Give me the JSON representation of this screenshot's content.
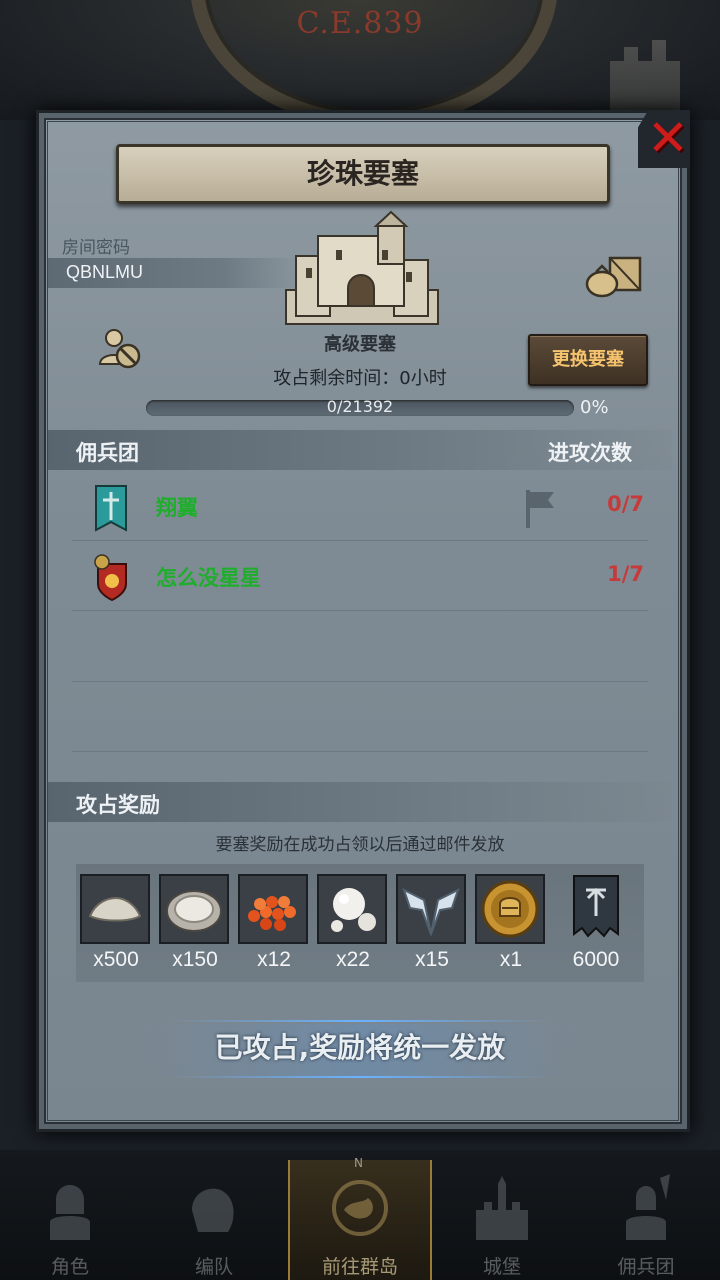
{
  "background": {
    "era": "C.E.839"
  },
  "panel": {
    "title": "珍珠要塞",
    "room_label": "房间密码",
    "room_code": "QBNLMU",
    "fortress_name": "高级要塞",
    "change_button": "更换要塞",
    "time_label": "攻占剩余时间：",
    "time_value": "0小时",
    "progress_text": "0/21392",
    "progress_percent": "0%",
    "progress_fraction": 0
  },
  "mercenary": {
    "header": "佣兵团",
    "attack_header": "进攻次数",
    "rows": [
      {
        "name": "翔翼",
        "count": "0/7"
      },
      {
        "name": "怎么没星星",
        "count": "1/7"
      }
    ]
  },
  "rewards": {
    "header": "攻占奖励",
    "note": "要塞奖励在成功占领以后通过邮件发放",
    "items": [
      {
        "icon": "flour-icon",
        "qty": "x500"
      },
      {
        "icon": "oyster-icon",
        "qty": "x150"
      },
      {
        "icon": "roe-icon",
        "qty": "x12"
      },
      {
        "icon": "pearl-icon",
        "qty": "x22"
      },
      {
        "icon": "wings-emblem-icon",
        "qty": "x15"
      },
      {
        "icon": "knight-coin-icon",
        "qty": "x1"
      },
      {
        "icon": "guild-banner-icon",
        "qty": "6000"
      }
    ]
  },
  "status": "已攻占,奖励将统一发放",
  "nav": {
    "items": [
      {
        "label": "角色"
      },
      {
        "label": "编队"
      },
      {
        "label": "前往群岛"
      },
      {
        "label": "城堡"
      },
      {
        "label": "佣兵团"
      }
    ],
    "compass_letter": "N"
  },
  "colors": {
    "ally_name": "#1fae2c",
    "attack_count": "#c73a3a",
    "close": "#d01b1b",
    "button_text": "#f6c46e"
  }
}
